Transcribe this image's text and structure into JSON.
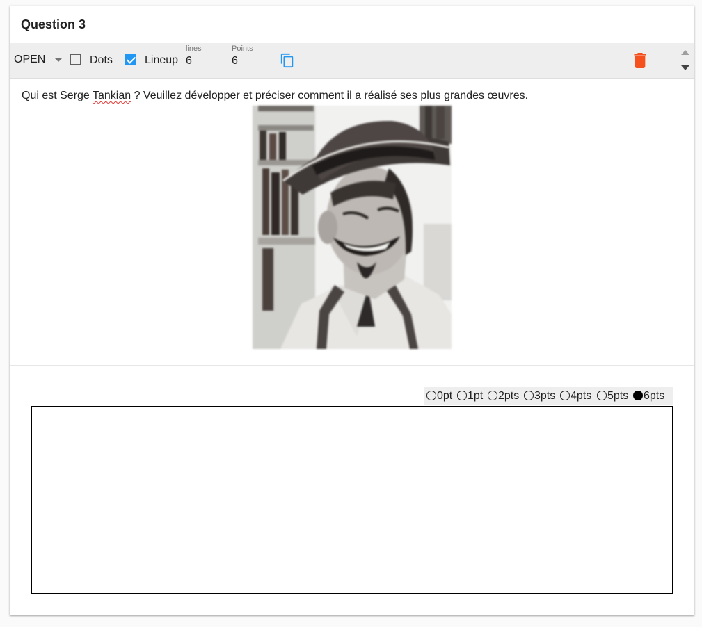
{
  "question": {
    "title": "Question 3",
    "text_before": "Qui est Serge ",
    "text_misspelled": "Tankian",
    "text_after": " ? Veuillez développer et préciser comment il a réalisé ses plus grandes œuvres."
  },
  "toolbar": {
    "type_value": "OPEN",
    "dots_label": "Dots",
    "dots_checked": false,
    "lineup_label": "Lineup",
    "lineup_checked": true,
    "lines_label": "lines",
    "lines_value": "6",
    "points_label": "Points",
    "points_value": "6",
    "icons": {
      "type_caret": "chevron-down-icon",
      "copy": "copy-icon",
      "delete": "trash-icon",
      "move_up": "arrow-up-icon",
      "move_down": "arrow-down-icon"
    }
  },
  "grading": {
    "options": [
      "0pt",
      "1pt",
      "2pts",
      "3pts",
      "4pts",
      "5pts",
      "6pts"
    ],
    "selected": "6pts"
  },
  "colors": {
    "accent": "#2196f3",
    "delete": "#f4511e",
    "toolbar_bg": "#eeeeee"
  }
}
